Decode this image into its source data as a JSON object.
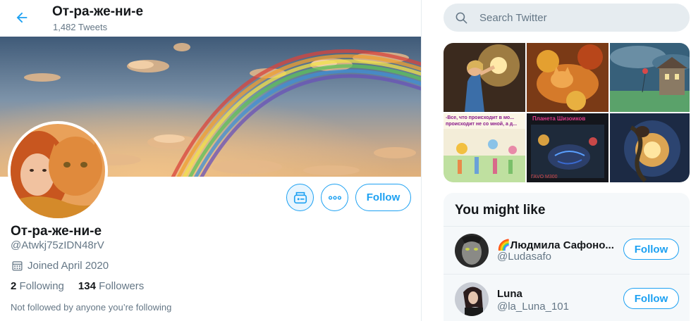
{
  "header": {
    "title": "От-ра-же-ни-е",
    "tweet_count": "1,482 Tweets"
  },
  "profile": {
    "name": "От-ра-же-ни-е",
    "handle": "@Atwkj75zIDN48rV",
    "joined": "Joined April 2020",
    "following_count": "2",
    "following_label": "Following",
    "followers_count": "134",
    "followers_label": "Followers",
    "not_followed": "Not followed by anyone you’re following",
    "follow_label": "Follow"
  },
  "search": {
    "placeholder": "Search Twitter"
  },
  "media": {
    "tiles": [
      {
        "caption": ""
      },
      {
        "caption": ""
      },
      {
        "caption": ""
      },
      {
        "caption": "-Все, что происходит в мо... происходит не со мной, а д..."
      },
      {
        "caption": "Планета Шизоиков"
      },
      {
        "caption": ""
      }
    ]
  },
  "you_might_like": {
    "title": "You might like",
    "accounts": [
      {
        "name": "🌈Людмила Сафоно...",
        "handle": "@Ludasafo",
        "follow_label": "Follow"
      },
      {
        "name": "Luna",
        "handle": "@la_Luna_101",
        "follow_label": "Follow"
      }
    ]
  },
  "colors": {
    "accent": "#1da1f2",
    "text_primary": "#14171a",
    "text_secondary": "#657786",
    "panel_bg": "#f5f8fa",
    "search_bg": "#e6ecf0"
  },
  "icons": [
    "back-arrow-icon",
    "newsletter-icon",
    "more-icon",
    "calendar-icon",
    "search-icon"
  ]
}
